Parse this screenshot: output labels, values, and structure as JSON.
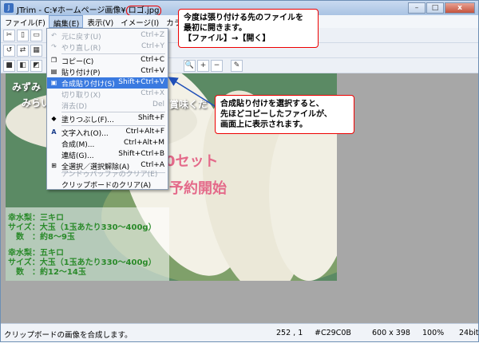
{
  "window": {
    "app_name": "JTrim - C:¥ホームページ画像¥",
    "file_name": "ロゴ.jpg",
    "buttons": [
      "–",
      "□",
      "x"
    ]
  },
  "menu": {
    "items": [
      "ファイル(F)",
      "編集(E)",
      "表示(V)",
      "イメージ(I)",
      "カラー(C)"
    ]
  },
  "edit_menu": {
    "rows": [
      {
        "label": "元に戻す(U)",
        "shortcut": "Ctrl+Z",
        "disabled": true
      },
      {
        "label": "やり直し(R)",
        "shortcut": "Ctrl+Y",
        "disabled": true
      },
      {
        "label": "コピー(C)",
        "shortcut": "Ctrl+C",
        "disabled": false
      },
      {
        "label": "貼り付け(P)",
        "shortcut": "Ctrl+V",
        "disabled": false
      },
      {
        "label": "合成貼り付け(S)",
        "shortcut": "Shift+Ctrl+V",
        "disabled": false
      },
      {
        "label": "切り取り(X)",
        "shortcut": "Ctrl+X",
        "disabled": true
      },
      {
        "label": "消去(D)",
        "shortcut": "Del",
        "disabled": true
      },
      {
        "label": "塗りつぶし(F)...",
        "shortcut": "Shift+F",
        "disabled": false
      },
      {
        "label": "文字入れ(O)...",
        "shortcut": "Ctrl+Alt+F",
        "disabled": false
      },
      {
        "label": "合成(M)...",
        "shortcut": "Ctrl+Alt+M",
        "disabled": false
      },
      {
        "label": "連結(G)...",
        "shortcut": "Shift+Ctrl+B",
        "disabled": false
      },
      {
        "label": "全選択／選択解除(A)",
        "shortcut": "Ctrl+A",
        "disabled": false
      },
      {
        "label": "アンドゥバッファのクリア(E)",
        "shortcut": "",
        "disabled": true
      },
      {
        "label": "クリップボードのクリア(A)",
        "shortcut": "",
        "disabled": false
      }
    ]
  },
  "callouts": {
    "top": [
      "今度は張り付ける先のファイルを",
      "最初に開きます。",
      "【ファイル】→【開く】"
    ],
    "right": [
      "合成貼り付けを選択すると、",
      "先ほどコピーしたファイルが、",
      "画面上に表示されます。"
    ]
  },
  "photo": {
    "line1": "みずみ",
    "line2": "みらい",
    "line_right": "賞味くだ",
    "promo1": "0セット",
    "promo2": "予約開始",
    "spec": [
      "幸水梨：三キロ",
      "サイズ：大玉（1玉あたり330〜400g）",
      "　数　：約8〜9玉",
      "幸水梨：五キロ",
      "サイズ：大玉（1玉あたり330〜400g）",
      "　数　：約12〜14玉"
    ]
  },
  "status": {
    "message": "クリップボードの画像を合成します。",
    "coords": "252 , 1",
    "color": "#C29C0B",
    "size": "600 x 398",
    "zoom": "100%",
    "depth": "24bit"
  },
  "colors": {
    "accent": "#e00000",
    "highlight": "#3a7ae0",
    "spec_text": "#2a8a2a",
    "promo": "#e46a8a"
  }
}
